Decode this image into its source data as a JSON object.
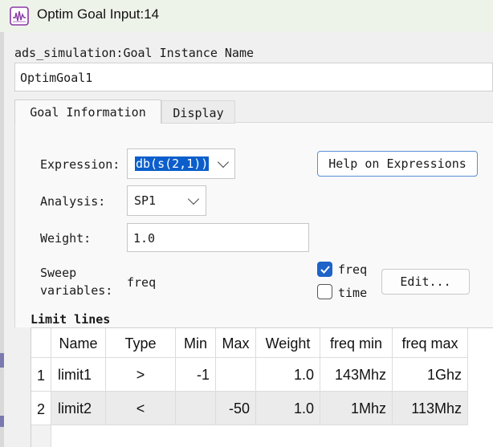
{
  "window": {
    "title": "Optim Goal Input:14"
  },
  "instance": {
    "label": "ads_simulation:Goal Instance Name",
    "value": "OptimGoal1"
  },
  "tabs": [
    {
      "label": "Goal Information",
      "active": true
    },
    {
      "label": "Display",
      "active": false
    }
  ],
  "form": {
    "expression_label": "Expression:",
    "expression_value": "db(s(2,1))",
    "help_button": "Help on Expressions",
    "analysis_label": "Analysis:",
    "analysis_value": "SP1",
    "weight_label": "Weight:",
    "weight_value": "1.0",
    "sweep_label_line1": "Sweep",
    "sweep_label_line2": "variables:",
    "sweep_value": "freq",
    "checkboxes": [
      {
        "label": "freq",
        "checked": true
      },
      {
        "label": "time",
        "checked": false
      }
    ],
    "edit_button": "Edit..."
  },
  "limit_lines": {
    "title": "Limit lines",
    "columns": [
      "Name",
      "Type",
      "Min",
      "Max",
      "Weight",
      "freq min",
      "freq max"
    ],
    "rows": [
      {
        "index": "1",
        "name": "limit1",
        "type": ">",
        "min": "-1",
        "max": "",
        "weight": "1.0",
        "freq_min": "143Mhz",
        "freq_max": "1Ghz"
      },
      {
        "index": "2",
        "name": "limit2",
        "type": "<",
        "min": "",
        "max": "-50",
        "weight": "1.0",
        "freq_min": "1Mhz",
        "freq_max": "113Mhz"
      }
    ]
  },
  "colors": {
    "accent": "#1e63c8",
    "selection": "#0b5ecb",
    "help_border": "#5b8ed6",
    "titlebar": "#eef3ea"
  },
  "icons": {
    "app": "waveform-icon",
    "dropdown": "chevron-down-icon",
    "check": "check-icon"
  }
}
